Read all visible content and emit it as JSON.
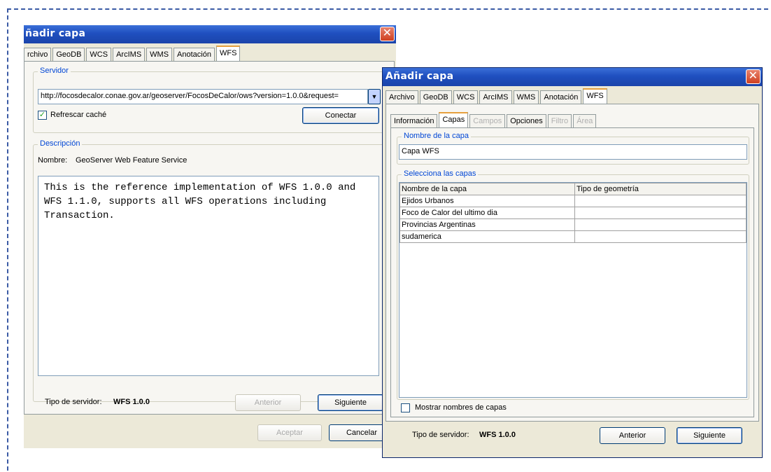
{
  "left_window": {
    "title": "ñadir capa",
    "close_glyph": "✕",
    "tabs": [
      "rchivo",
      "GeoDB",
      "WCS",
      "ArcIMS",
      "WMS",
      "Anotación",
      "WFS"
    ],
    "server_group_label": "Servidor",
    "server_url": "http://focosdecalor.conae.gov.ar/geoserver/FocosDeCalor/ows?version=1.0.0&request=",
    "dropdown_glyph": "▼",
    "refresh_cache_label": "Refrescar caché",
    "refresh_cache_checked": true,
    "connect_button": "Conectar",
    "description_group_label": "Descripción",
    "name_label": "Nombre:",
    "name_value": "GeoServer Web Feature Service",
    "description_text": "This is the reference implementation of WFS 1.0.0 and\nWFS 1.1.0, supports all WFS operations including\nTransaction.",
    "server_type_label": "Tipo de servidor:",
    "server_type_value": "WFS 1.0.0",
    "previous_button": "Anterior",
    "next_button": "Siguiente",
    "accept_button": "Aceptar",
    "cancel_button": "Cancelar"
  },
  "right_window": {
    "title": "Añadir capa",
    "close_glyph": "✕",
    "tabs": [
      "Archivo",
      "GeoDB",
      "WCS",
      "ArcIMS",
      "WMS",
      "Anotación",
      "WFS"
    ],
    "subtabs": [
      "Información",
      "Capas",
      "Campos",
      "Opciones",
      "Filtro",
      "Área"
    ],
    "layer_name_group_label": "Nombre de la capa",
    "layer_name_value": "Capa WFS",
    "select_layers_group_label": "Selecciona las capas",
    "table": {
      "headers": [
        "Nombre de la capa",
        "Tipo de geometría"
      ],
      "rows": [
        [
          "Ejidos Urbanos",
          ""
        ],
        [
          "Foco de Calor del ultimo dia",
          ""
        ],
        [
          "Provincias Argentinas",
          ""
        ],
        [
          "sudamerica",
          ""
        ]
      ]
    },
    "show_layer_names_label": "Mostrar nombres de capas",
    "show_layer_names_checked": false,
    "server_type_label": "Tipo de servidor:",
    "server_type_value": "WFS 1.0.0",
    "previous_button": "Anterior",
    "next_button": "Siguiente"
  },
  "colors": {
    "title_bar": "#1f4fbf",
    "group_label": "#0046d5",
    "dialog_bg": "#ece9d8",
    "frame_dash": "#3b5ba5"
  }
}
